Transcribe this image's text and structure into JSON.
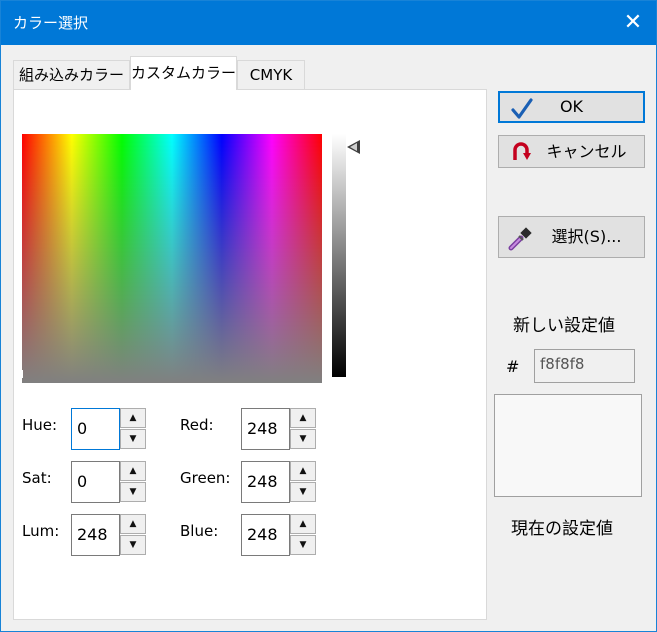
{
  "window": {
    "title": "カラー選択",
    "close_glyph": "✕"
  },
  "tabs": [
    {
      "label": "組み込みカラー"
    },
    {
      "label": "カスタムカラー",
      "active": true
    },
    {
      "label": "CMYK"
    }
  ],
  "fields": {
    "hue": {
      "label": "Hue:",
      "value": "0"
    },
    "sat": {
      "label": "Sat:",
      "value": "0"
    },
    "lum": {
      "label": "Lum:",
      "value": "248"
    },
    "red": {
      "label": "Red:",
      "value": "248"
    },
    "green": {
      "label": "Green:",
      "value": "248"
    },
    "blue": {
      "label": "Blue:",
      "value": "248"
    }
  },
  "buttons": {
    "ok": "OK",
    "cancel": "キャンセル",
    "pick": "選択(S)..."
  },
  "new_value_label": "新しい設定値",
  "hex_prefix": "#",
  "hex_value": "f8f8f8",
  "current_value_label": "現在の設定値",
  "colors": {
    "accent": "#0078d7",
    "current_swatch": "#f8f8f8",
    "cancel_icon": "#c4001e",
    "ok_icon": "#1a5fb4"
  },
  "icons": {
    "ok": "checkmark-icon",
    "cancel": "undo-arrow-icon",
    "pick": "eyedropper-icon"
  }
}
